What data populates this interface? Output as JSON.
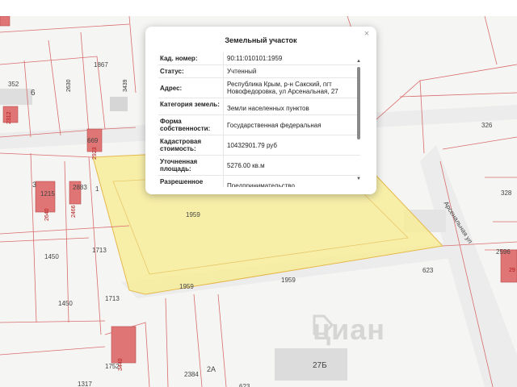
{
  "popup": {
    "title": "Земельный участок",
    "close_glyph": "×",
    "rows": [
      {
        "key": "Кад. номер:",
        "value": "90:11:010101:1959"
      },
      {
        "key": "Статус:",
        "value": "Учтенный"
      },
      {
        "key": "Адрес:",
        "value": "Республика Крым, р-н Сакский, пгт Новофедоровка, ул Арсенальная, 27"
      },
      {
        "key": "Категория земель:",
        "value": "Земли населенных пунктов"
      },
      {
        "key": "Форма собственности:",
        "value": "Государственная федеральная"
      },
      {
        "key": "Кадастровая стоимость:",
        "value": "10432901.79 руб"
      },
      {
        "key": "Уточненная площадь:",
        "value": "5276.00 кв.м"
      },
      {
        "key": "Разрешенное использование:",
        "value": "Предпринимательство"
      }
    ],
    "scroll_up_glyph": "▲",
    "scroll_down_glyph": "▼"
  },
  "map": {
    "street_label": "Арсенальная ул",
    "watermark": "циан",
    "parcel_labels": [
      {
        "text": "352"
      },
      {
        "text": "6"
      },
      {
        "text": "2630"
      },
      {
        "text": "1867"
      },
      {
        "text": "3439"
      },
      {
        "text": "2312"
      },
      {
        "text": "669"
      },
      {
        "text": "2923"
      },
      {
        "text": "3"
      },
      {
        "text": "1215"
      },
      {
        "text": "2883"
      },
      {
        "text": "1959"
      },
      {
        "text": "1713"
      },
      {
        "text": "1450"
      },
      {
        "text": "1713"
      },
      {
        "text": "1450"
      },
      {
        "text": "1959"
      },
      {
        "text": "1959"
      },
      {
        "text": "623"
      },
      {
        "text": "326"
      },
      {
        "text": "328"
      },
      {
        "text": "2596"
      },
      {
        "text": "1752"
      },
      {
        "text": "2384"
      },
      {
        "text": "2А"
      },
      {
        "text": "1317"
      },
      {
        "text": "623"
      },
      {
        "text": "27Б"
      },
      {
        "text": "1"
      }
    ],
    "building_labels": [
      {
        "text": "2312"
      },
      {
        "text": "2923"
      },
      {
        "text": "2640"
      },
      {
        "text": "2466"
      },
      {
        "text": "3440"
      },
      {
        "text": "29"
      }
    ]
  },
  "colors": {
    "parcel_line": "#d96c6c",
    "highlight_fill": "#f7ec9a",
    "highlight_stroke": "#e6b84a",
    "building": "#e07575"
  }
}
